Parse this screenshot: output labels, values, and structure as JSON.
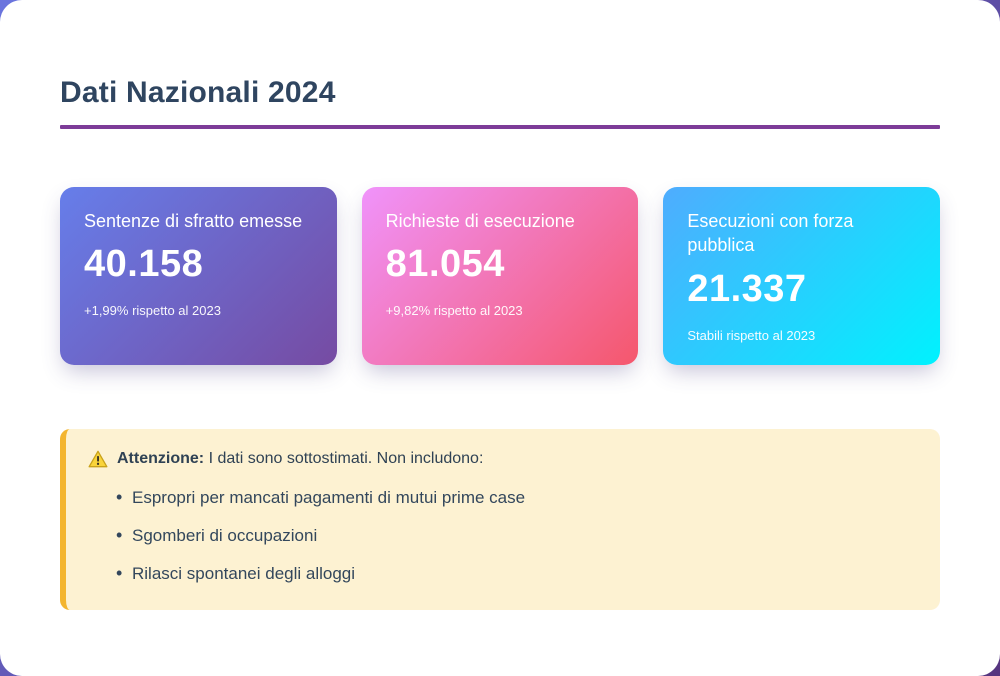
{
  "page": {
    "title": "Dati Nazionali 2024"
  },
  "cards": [
    {
      "label": "Sentenze di sfratto emesse",
      "value": "40.158",
      "note": "+1,99% rispetto al 2023",
      "gradient": [
        "#667eea",
        "#764ba2"
      ]
    },
    {
      "label": "Richieste di esecuzione",
      "value": "81.054",
      "note": "+9,82% rispetto al 2023",
      "gradient": [
        "#f093fb",
        "#f5576c"
      ]
    },
    {
      "label": "Esecuzioni con forza pubblica",
      "value": "21.337",
      "note": "Stabili rispetto al 2023",
      "gradient": [
        "#4facfe",
        "#00f2fe"
      ]
    }
  ],
  "warning": {
    "icon": "warning-triangle-icon",
    "title": "Attenzione:",
    "text": "I dati sono sottostimati. Non includono:",
    "items": [
      "Espropri per mancati pagamenti di mutui prime case",
      "Sgomberi di occupazioni",
      "Rilasci spontanei degli alloggi"
    ]
  },
  "colors": {
    "page_background_gradient": [
      "#6a74de",
      "#56357f"
    ],
    "title_text": "#2f4560",
    "title_underline": "#7d3c98",
    "warning_background": "#fdf2d2",
    "warning_border": "#f3b52f",
    "body_text": "#33475c"
  }
}
